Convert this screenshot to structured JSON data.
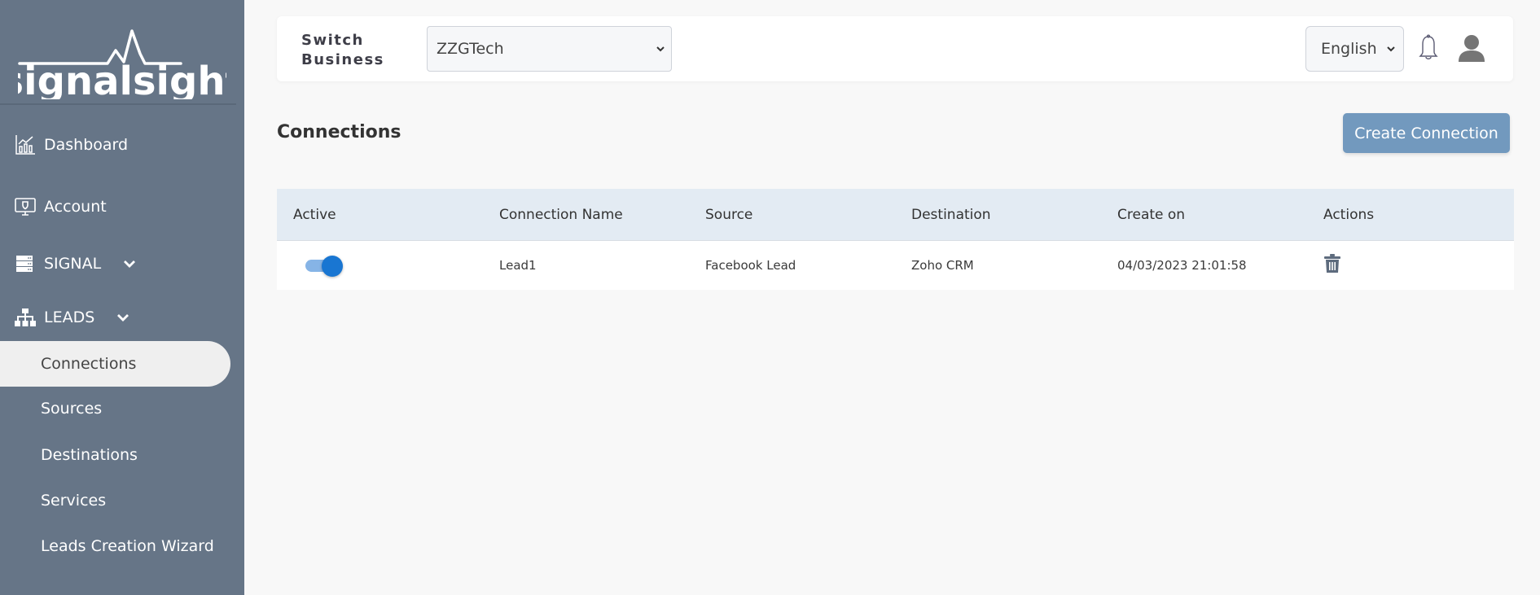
{
  "brand": {
    "name": "signalsight"
  },
  "sidebar": {
    "items": [
      {
        "label": "Dashboard",
        "icon": "chart-icon"
      },
      {
        "label": "Account",
        "icon": "monitor-shield-icon"
      },
      {
        "label": "SIGNAL",
        "icon": "server-icon",
        "expandable": true
      },
      {
        "label": "LEADS",
        "icon": "sitemap-icon",
        "expandable": true
      }
    ],
    "leads_subitems": [
      {
        "label": "Connections",
        "active": true
      },
      {
        "label": "Sources"
      },
      {
        "label": "Destinations"
      },
      {
        "label": "Services"
      },
      {
        "label": "Leads Creation Wizard"
      }
    ]
  },
  "header": {
    "switch_label_line1": "Switch",
    "switch_label_line2": "Business",
    "business_selected": "ZZGTech",
    "language_selected": "English"
  },
  "main": {
    "title": "Connections",
    "create_button": "Create Connection",
    "table": {
      "columns": [
        "Active",
        "Connection Name",
        "Source",
        "Destination",
        "Create on",
        "Actions"
      ],
      "rows": [
        {
          "active": true,
          "name": "Lead1",
          "source": "Facebook Lead",
          "destination": "Zoho CRM",
          "created": "04/03/2023 21:01:58"
        }
      ]
    }
  },
  "colors": {
    "sidebar_bg": "#667587",
    "accent_button": "#7299be",
    "toggle_on": "#1976d2",
    "table_header_bg": "#e3ebf3"
  }
}
